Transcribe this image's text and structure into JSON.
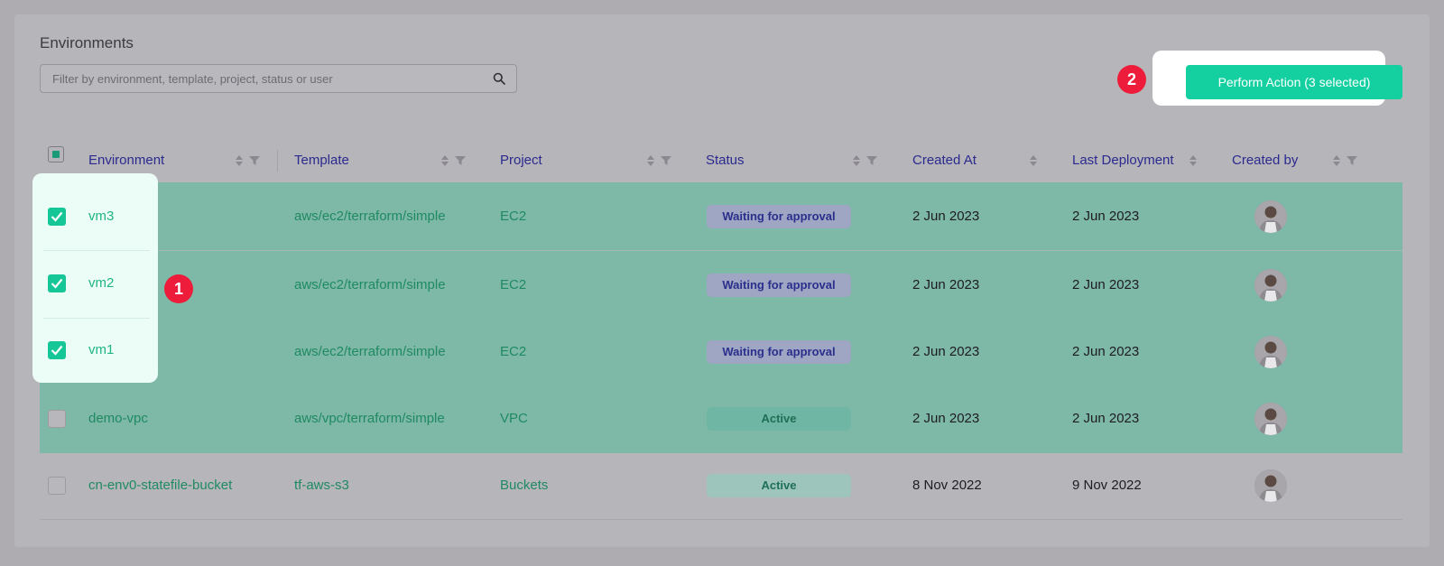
{
  "page": {
    "title": "Environments",
    "search_placeholder": "Filter by environment, template, project, status or user",
    "action_button": "Perform Action (3 selected)"
  },
  "annotations": {
    "step1": "1",
    "step2": "2"
  },
  "columns": {
    "environment": "Environment",
    "template": "Template",
    "project": "Project",
    "status": "Status",
    "created_at": "Created At",
    "last_deployment": "Last Deployment",
    "created_by": "Created by"
  },
  "rows": [
    {
      "environment": "vm3",
      "template": "aws/ec2/terraform/simple",
      "project": "EC2",
      "status": "Waiting for approval",
      "created_at": "2 Jun 2023",
      "last_deployment": "2 Jun 2023",
      "selected": true
    },
    {
      "environment": "vm2",
      "template": "aws/ec2/terraform/simple",
      "project": "EC2",
      "status": "Waiting for approval",
      "created_at": "2 Jun 2023",
      "last_deployment": "2 Jun 2023",
      "selected": true
    },
    {
      "environment": "vm1",
      "template": "aws/ec2/terraform/simple",
      "project": "EC2",
      "status": "Waiting for approval",
      "created_at": "2 Jun 2023",
      "last_deployment": "2 Jun 2023",
      "selected": true
    },
    {
      "environment": "demo-vpc",
      "template": "aws/vpc/terraform/simple",
      "project": "VPC",
      "status": "Active",
      "created_at": "2 Jun 2023",
      "last_deployment": "2 Jun 2023",
      "selected": false
    },
    {
      "environment": "cn-env0-statefile-bucket",
      "template": "tf-aws-s3",
      "project": "Buckets",
      "status": "Active",
      "created_at": "8 Nov 2022",
      "last_deployment": "9 Nov 2022",
      "selected": false
    }
  ],
  "colors": {
    "accent": "#14d0a1",
    "link": "#1f8a62",
    "header": "#2b2a8f",
    "badge": "#ed1c3b"
  },
  "icons": {
    "search": "search-icon",
    "sort": "sort-icon",
    "filter": "filter-icon",
    "checkbox": "checkbox-icon",
    "avatar": "avatar"
  }
}
